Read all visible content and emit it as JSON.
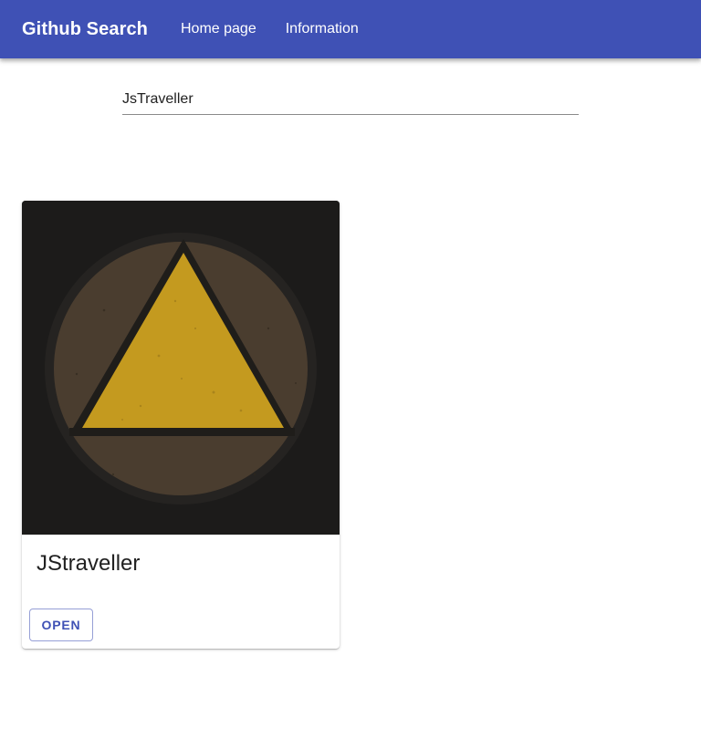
{
  "appbar": {
    "title": "Github Search",
    "nav": {
      "home_label": "Home page",
      "info_label": "Information"
    },
    "color": "#3f51b5"
  },
  "search": {
    "value": "JsTraveller",
    "placeholder": ""
  },
  "results": [
    {
      "name": "JStraveller",
      "avatar_icon": "triangle-in-circle-avatar",
      "open_label": "OPEN"
    }
  ],
  "colors": {
    "accent": "#3f51b5",
    "avatar_background": "#1c1b1a",
    "avatar_circle": "#4a3d2f",
    "avatar_triangle": "#c49a1f"
  }
}
